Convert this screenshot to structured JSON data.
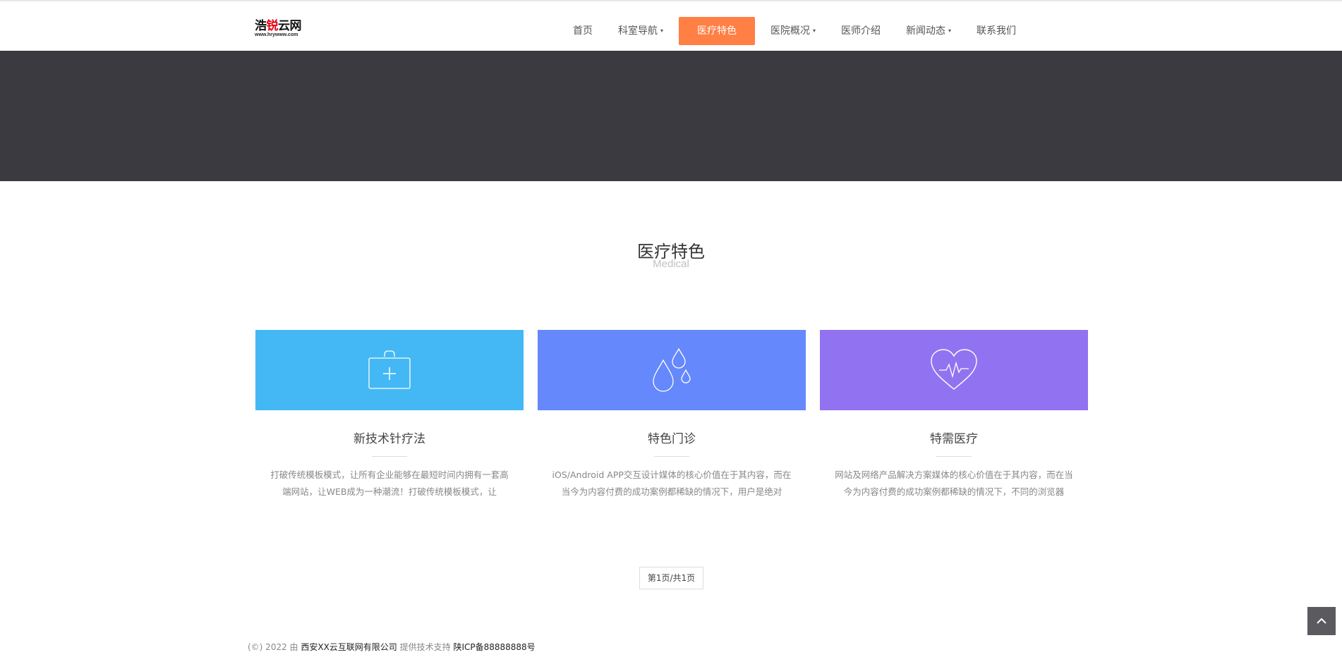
{
  "brand": {
    "name_part1": "浩",
    "name_highlight": "锐",
    "name_part2": "云网",
    "url_text": "www.hrywww.com"
  },
  "nav": {
    "items": [
      {
        "label": "首页",
        "has_dropdown": false,
        "active": false
      },
      {
        "label": "科室导航",
        "has_dropdown": true,
        "active": false
      },
      {
        "label": "医疗特色",
        "has_dropdown": false,
        "active": true
      },
      {
        "label": "医院概况",
        "has_dropdown": true,
        "active": false
      },
      {
        "label": "医师介绍",
        "has_dropdown": false,
        "active": false
      },
      {
        "label": "新闻动态",
        "has_dropdown": true,
        "active": false
      },
      {
        "label": "联系我们",
        "has_dropdown": false,
        "active": false
      }
    ],
    "caret": "▾"
  },
  "section": {
    "title": "医疗特色",
    "subtitle": "Medical"
  },
  "cards": [
    {
      "icon": "medical-kit-icon",
      "color": "#44b8f5",
      "title": "新技术针疗法",
      "desc": "打破传统模板模式，让所有企业能够在最短时间内拥有一套高端网站，让WEB成为一种潮流！打破传统模板模式，让"
    },
    {
      "icon": "water-drops-icon",
      "color": "#6588fc",
      "title": "特色门诊",
      "desc": "iOS/Android APP交互设计媒体的核心价值在于其内容，而在当今为内容付费的成功案例都稀缺的情况下，用户是绝对"
    },
    {
      "icon": "heart-pulse-icon",
      "color": "#9173f1",
      "title": "特需医疗",
      "desc": "网站及网络产品解决方案媒体的核心价值在于其内容，而在当今为内容付费的成功案例都稀缺的情况下，不同的浏览器"
    }
  ],
  "pager": {
    "label": "第1页/共1页"
  },
  "footer": {
    "prefix": "(©) 2022 由 ",
    "company": "西安XX云互联网有限公司",
    "middle": " 提供技术支持 ",
    "icp": "陕ICP备88888888号"
  },
  "colors": {
    "accent": "#ff7f45",
    "banner": "#3b3a40"
  }
}
